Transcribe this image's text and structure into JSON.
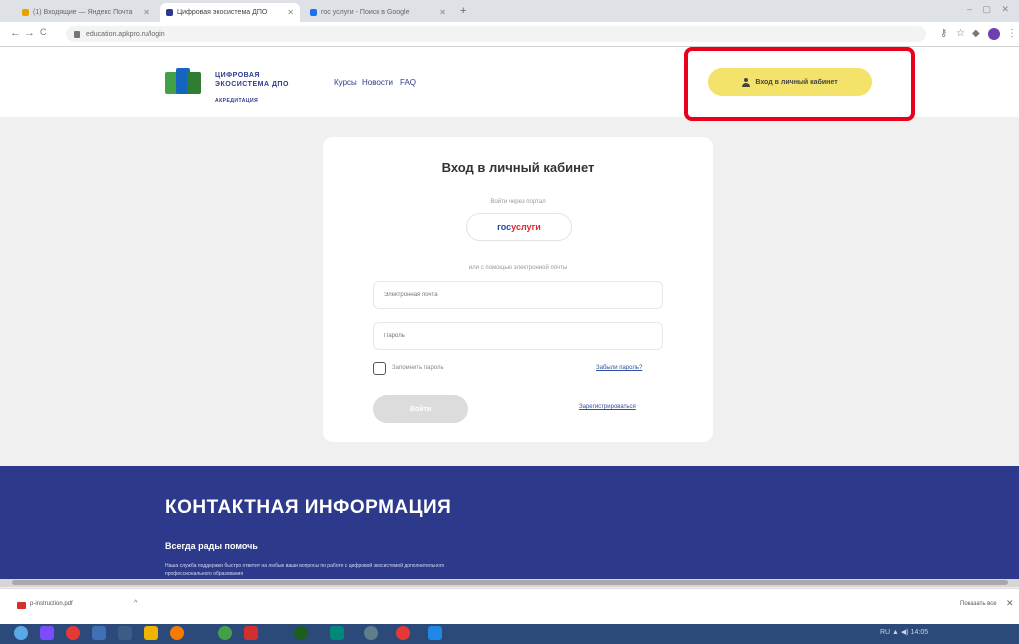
{
  "browser": {
    "tabs": [
      {
        "label": "(1) Входящие — Яндекс Почта",
        "color": "#e8a200"
      },
      {
        "label": "Цифровая экосистема ДПО",
        "color": "#2d3a8c",
        "active": true
      },
      {
        "label": "гос услуги - Поиск в Google",
        "color": "#1a73e8"
      }
    ],
    "new_tab": "+",
    "window_controls": "– ▢ ✕",
    "url": "education.apkpro.ru/login",
    "back": "←",
    "forward": "→",
    "reload": "C"
  },
  "header": {
    "logo_line1": "ЦИФРОВАЯ",
    "logo_line2": "ЭКОСИСТЕМА ДПО",
    "logo_sub": "АКРЕДИТАЦИЯ",
    "nav": [
      "Курсы",
      "Новости",
      "FAQ"
    ],
    "login_button": "Вход в личный кабинет",
    "accent": "#f3e36a",
    "highlight_color": "#e8001c"
  },
  "login": {
    "title": "Вход в личный кабинет",
    "via_label": "Войти через портал",
    "gosuslugi_a": "гос",
    "gosuslugi_b": "услуги",
    "or_label": "или с помощью электронной почты",
    "email_placeholder": "Электронная почта",
    "password_placeholder": "Пароль",
    "remember": "Запомнить пароль",
    "forgot": "Забыли пароль?",
    "submit": "Войти",
    "register": "Зарегистрироваться"
  },
  "footer": {
    "heading": "КОНТАКТНАЯ ИНФОРМАЦИЯ",
    "subheading": "Всегда рады помочь",
    "text": "Наша служба поддержки быстро ответит на любые ваши вопросы по работе с цифровой экосистемой дополнительного профессионального образования",
    "bg": "#2d3a8c"
  },
  "downloads": {
    "file": "p-instruction.pdf",
    "chevron": "^",
    "show_all": "Показать все",
    "close": "✕"
  },
  "taskbar": {
    "tray": "RU  ▲  ◀)  14:05"
  }
}
